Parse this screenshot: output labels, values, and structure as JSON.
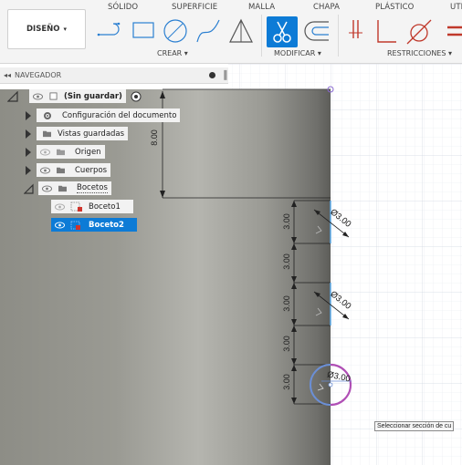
{
  "toolbar": {
    "tabs": [
      "SÓLIDO",
      "SUPERFICIE",
      "MALLA",
      "CHAPA",
      "PLÁSTICO",
      "UTI"
    ],
    "workspace_label": "DISEÑO",
    "groups": {
      "create": "CREAR ▾",
      "modify": "MODIFICAR ▾",
      "constraints": "RESTRICCIONES ▾"
    },
    "accent_color": "#0d7bd6"
  },
  "navigator": {
    "title": "NAVEGADOR",
    "root": "(Sin guardar)",
    "items": [
      {
        "label": "Configuración del documento",
        "icon": "gear-icon"
      },
      {
        "label": "Vistas guardadas",
        "icon": "folder-icon"
      },
      {
        "label": "Origen",
        "icon": "folder-icon"
      },
      {
        "label": "Cuerpos",
        "icon": "folder-icon"
      },
      {
        "label": "Bocetos",
        "icon": "folder-icon"
      }
    ],
    "sketches": [
      {
        "label": "Boceto1",
        "selected": false
      },
      {
        "label": "Boceto2",
        "selected": true
      }
    ]
  },
  "dimensions": {
    "top_length": "8.00",
    "spacings": [
      "3.00",
      "3.00",
      "3.00",
      "3.00",
      "3.00"
    ],
    "diameters": [
      "Ø3.00",
      "Ø3.00",
      "Ø3.00"
    ]
  },
  "tooltip": "Seleccionar sección de cu"
}
